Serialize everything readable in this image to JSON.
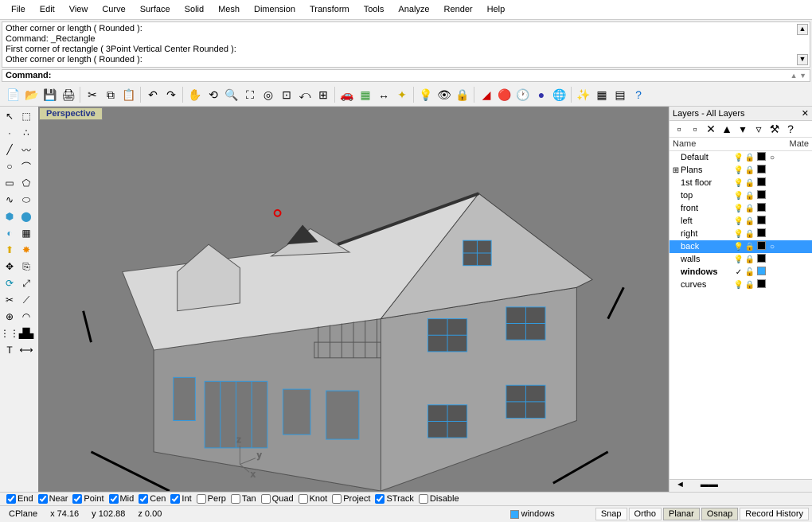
{
  "menu": [
    "File",
    "Edit",
    "View",
    "Curve",
    "Surface",
    "Solid",
    "Mesh",
    "Dimension",
    "Transform",
    "Tools",
    "Analyze",
    "Render",
    "Help"
  ],
  "command_history": [
    "Other corner or length ( Rounded ):",
    "Command: _Rectangle",
    "First corner of rectangle ( 3Point  Vertical  Center  Rounded ):",
    "Other corner or length ( Rounded ):"
  ],
  "command_prompt_label": "Command:",
  "command_prompt_value": "",
  "viewport_label": "Perspective",
  "layers_panel": {
    "title": "Layers - All Layers",
    "col_name": "Name",
    "col_mate": "Mate",
    "rows": [
      {
        "name": "Default",
        "expand": "",
        "bulb": "yellow",
        "lock": true,
        "color": "#000000",
        "mat": "circle",
        "selected": false,
        "bold": false
      },
      {
        "name": "Plans",
        "expand": "+",
        "bulb": "blue",
        "lock": true,
        "color": "#000000",
        "mat": "",
        "selected": false,
        "bold": false
      },
      {
        "name": "1st floor",
        "expand": "",
        "bulb": "yellow",
        "lock": true,
        "color": "#000000",
        "mat": "",
        "selected": false,
        "bold": false
      },
      {
        "name": "top",
        "expand": "",
        "bulb": "yellow",
        "lock": true,
        "color": "#000000",
        "mat": "",
        "selected": false,
        "bold": false
      },
      {
        "name": "front",
        "expand": "",
        "bulb": "yellow",
        "lock": true,
        "color": "#000000",
        "mat": "",
        "selected": false,
        "bold": false
      },
      {
        "name": "left",
        "expand": "",
        "bulb": "yellow",
        "lock": true,
        "color": "#000000",
        "mat": "",
        "selected": false,
        "bold": false
      },
      {
        "name": "right",
        "expand": "",
        "bulb": "yellow",
        "lock": true,
        "color": "#000000",
        "mat": "",
        "selected": false,
        "bold": false
      },
      {
        "name": "back",
        "expand": "",
        "bulb": "yellow",
        "lock": true,
        "color": "#000000",
        "mat": "circle",
        "selected": true,
        "bold": false
      },
      {
        "name": "walls",
        "expand": "",
        "bulb": "yellow",
        "lock": true,
        "color": "#000000",
        "mat": "",
        "selected": false,
        "bold": false
      },
      {
        "name": "windows",
        "expand": "",
        "bulb": "check",
        "lock": false,
        "color": "#33aaff",
        "mat": "",
        "selected": false,
        "bold": true
      },
      {
        "name": "curves",
        "expand": "",
        "bulb": "yellow",
        "lock": true,
        "color": "#000000",
        "mat": "",
        "selected": false,
        "bold": false
      }
    ]
  },
  "osnap": [
    {
      "label": "End",
      "checked": true
    },
    {
      "label": "Near",
      "checked": true
    },
    {
      "label": "Point",
      "checked": true
    },
    {
      "label": "Mid",
      "checked": true
    },
    {
      "label": "Cen",
      "checked": true
    },
    {
      "label": "Int",
      "checked": true
    },
    {
      "label": "Perp",
      "checked": false
    },
    {
      "label": "Tan",
      "checked": false
    },
    {
      "label": "Quad",
      "checked": false
    },
    {
      "label": "Knot",
      "checked": false
    },
    {
      "label": "Project",
      "checked": false
    },
    {
      "label": "STrack",
      "checked": true
    },
    {
      "label": "Disable",
      "checked": false
    }
  ],
  "status": {
    "cplane": "CPlane",
    "x": "x 74.16",
    "y": "y 102.88",
    "z": "z 0.00",
    "layer_color": "#33aaff",
    "layer_name": "windows",
    "buttons": [
      "Snap",
      "Ortho",
      "Planar",
      "Osnap",
      "Record History"
    ],
    "active": [
      "Planar",
      "Osnap"
    ]
  }
}
